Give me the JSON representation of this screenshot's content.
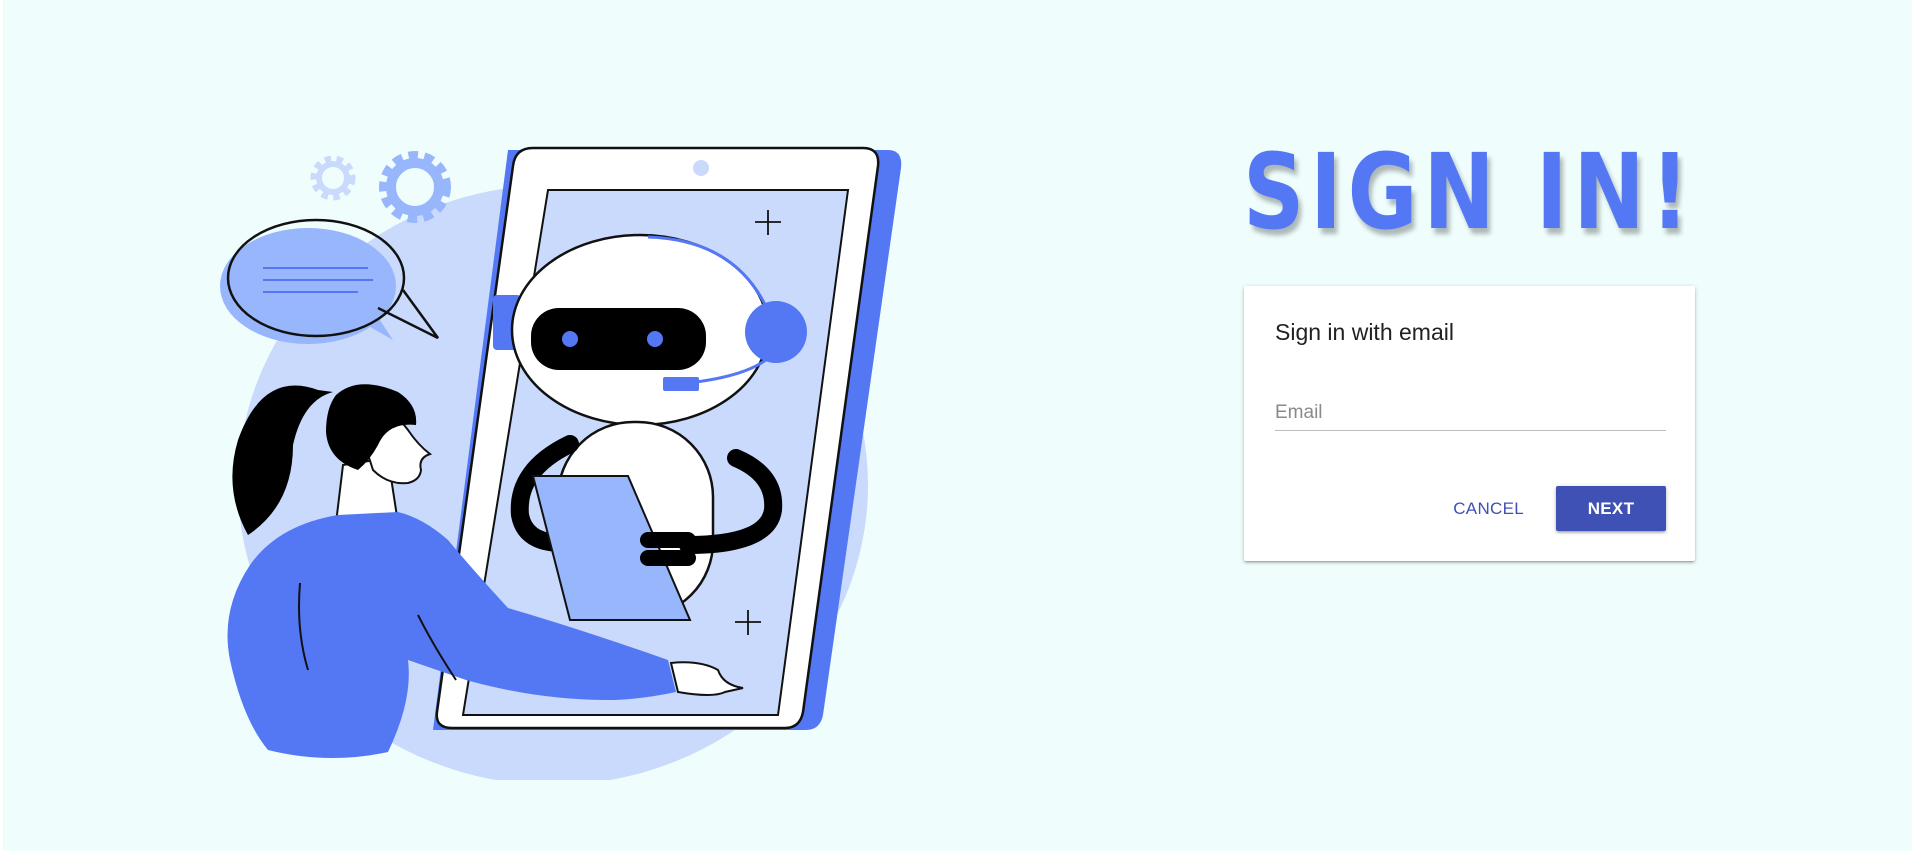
{
  "heading": {
    "text": "SIGN IN!"
  },
  "card": {
    "title": "Sign in with email",
    "email_field": {
      "value": "",
      "placeholder": "Email"
    },
    "cancel_label": "CANCEL",
    "next_label": "NEXT"
  },
  "colors": {
    "background": "#effefd",
    "accent_blue": "#5478f4",
    "light_blue": "#c9dafc",
    "mid_blue": "#98b6fb",
    "primary_button": "#3f51b5"
  },
  "illustration": {
    "icon": "woman-with-chatbot-robot-phone-illustration"
  }
}
